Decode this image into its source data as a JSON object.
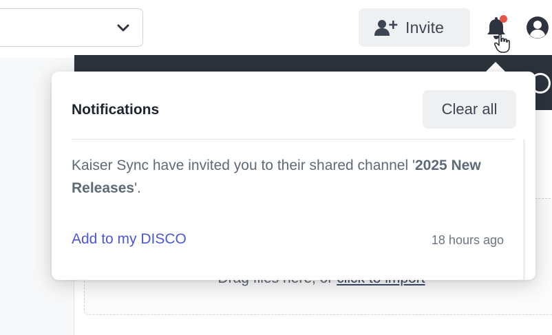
{
  "topbar": {
    "select": {
      "value": "",
      "icon": "chevron-down-icon"
    },
    "invite": {
      "label": "Invite",
      "icon": "add-user-icon"
    },
    "notifications": {
      "icon": "bell-icon",
      "has_unread": true,
      "badge_color": "#e8534a"
    },
    "account": {
      "icon": "user-circle-icon"
    }
  },
  "background": {
    "header_color": "#2d333c",
    "dropzone": {
      "text_prefix": "Drag files here, or ",
      "link": "click to import"
    }
  },
  "notifications_panel": {
    "title": "Notifications",
    "clear_all_label": "Clear all",
    "items": [
      {
        "message_prefix": "Kaiser Sync have invited you to their shared channel '",
        "channel_name": "2025 New Releases",
        "message_suffix": "'.",
        "action_label": "Add to my DISCO",
        "time": "18 hours ago"
      }
    ]
  },
  "colors": {
    "link": "#4a57d6",
    "badge": "#e8534a"
  }
}
